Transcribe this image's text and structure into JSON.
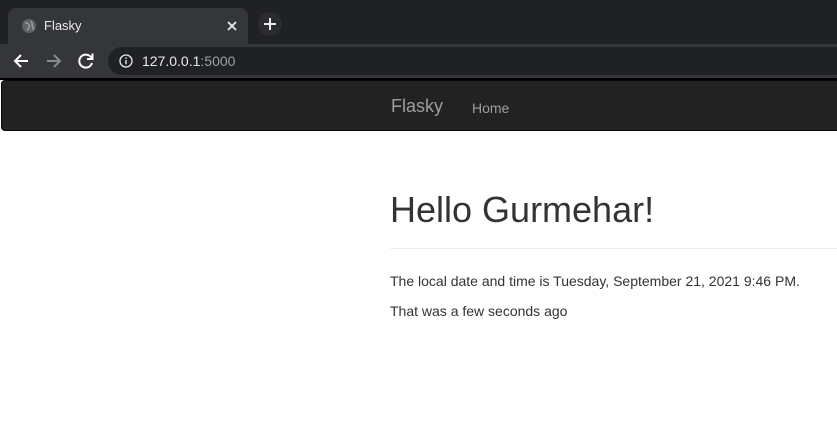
{
  "browser": {
    "tab": {
      "title": "Flasky"
    },
    "address": {
      "host": "127.0.0.1",
      "port": ":5000"
    }
  },
  "navbar": {
    "brand": "Flasky",
    "links": [
      {
        "label": "Home"
      }
    ]
  },
  "content": {
    "heading": "Hello Gurmehar!",
    "datetime_text": "The local date and time is Tuesday, September 21, 2021 9:46 PM.",
    "relative_text": "That was a few seconds ago"
  },
  "icons": {
    "favicon": "globe-icon",
    "close": "close-icon",
    "new_tab": "plus-icon",
    "back": "arrow-left-icon",
    "forward": "arrow-right-icon",
    "reload": "reload-icon",
    "info": "info-icon"
  },
  "colors": {
    "chrome_dark": "#202124",
    "chrome_tab": "#35363a",
    "navbar_bg": "#222222",
    "navbar_text": "#9d9d9d",
    "body_text": "#333333"
  }
}
